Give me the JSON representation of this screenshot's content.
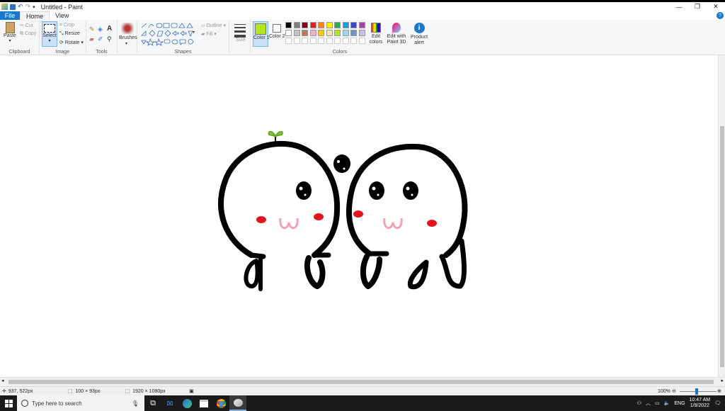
{
  "window": {
    "title": "Untitled - Paint"
  },
  "menu": {
    "file": "File",
    "home": "Home",
    "view": "View",
    "help": "?"
  },
  "ribbon": {
    "clipboard": {
      "label": "Clipboard",
      "paste": "Paste",
      "cut": "Cut",
      "copy": "Copy"
    },
    "image": {
      "label": "Image",
      "select": "Select",
      "crop": "Crop",
      "resize": "Resize",
      "rotate": "Rotate"
    },
    "tools": {
      "label": "Tools"
    },
    "brushes": {
      "label": "Brushes"
    },
    "shapes": {
      "label": "Shapes",
      "outline": "Outline",
      "fill": "Fill"
    },
    "size": {
      "label": "Size"
    },
    "colors": {
      "label": "Colors",
      "color1": "Color 1",
      "color2": "Color 2",
      "edit": "Edit colors",
      "paint3d": "Edit with Paint 3D",
      "alert": "Product alert",
      "color1_value": "#b5e61d",
      "color2_value": "#ffffff",
      "palette_row1": [
        "#000000",
        "#7f7f7f",
        "#880015",
        "#ed1c24",
        "#ff7f27",
        "#fff200",
        "#22b14c",
        "#00a2e8",
        "#3f48cc",
        "#a349a4"
      ],
      "palette_row2": [
        "#ffffff",
        "#c3c3c3",
        "#b97a57",
        "#ffaec9",
        "#ffc90e",
        "#efe4b0",
        "#b5e61d",
        "#99d9ea",
        "#7092be",
        "#c8bfe7"
      ]
    }
  },
  "status": {
    "cursor": "937, 522px",
    "selection": "100 × 93px",
    "image_size": "1920 × 1080px",
    "zoom": "100%"
  },
  "taskbar": {
    "search_placeholder": "Type here to search",
    "lang": "ENG",
    "time": "10:47 AM",
    "date": "1/9/2022"
  }
}
